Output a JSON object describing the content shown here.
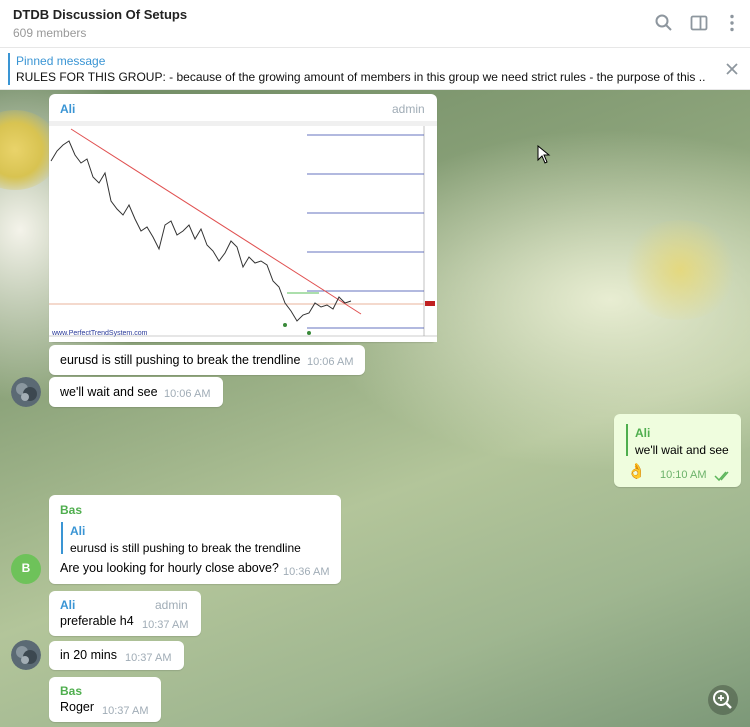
{
  "header": {
    "title": "DTDB Discussion Of Setups",
    "members": "609 members",
    "icons": [
      "search-icon",
      "sidebar-icon",
      "more-icon"
    ]
  },
  "pinned": {
    "title": "Pinned message",
    "text": "RULES FOR THIS GROUP:  - because of the growing amount of members in this group we need strict rules - the purpose of this ..."
  },
  "messages": [
    {
      "author": "Ali",
      "role": "admin",
      "has_image": true,
      "image_watermark": "www.PerfectTrendSystem.com",
      "text": "eurusd is still pushing to break the trendline",
      "time": "10:06 AM"
    },
    {
      "text": "we'll wait and see",
      "time": "10:06 AM"
    },
    {
      "outgoing": true,
      "reply_to": {
        "author": "Ali",
        "text": "we'll wait and see"
      },
      "text": "👌",
      "time": "10:10 AM"
    },
    {
      "author": "Bas",
      "avatar_letter": "B",
      "reply_to": {
        "author": "Ali",
        "text": "eurusd is still pushing to break the trendline"
      },
      "text": "Are you looking for hourly close above?",
      "time": "10:36 AM"
    },
    {
      "author": "Ali",
      "role": "admin",
      "text": "preferable h4",
      "time": "10:37 AM"
    },
    {
      "text": "in 20 mins",
      "time": "10:37 AM"
    },
    {
      "author": "Bas",
      "text": "Roger",
      "time": "10:37 AM"
    }
  ],
  "colors": {
    "accent": "#3a95d4",
    "ali_name": "#3a95d4",
    "bas_name": "#4fae4e",
    "bas_avatar": "#6ec25a",
    "outgoing_bubble": "#effdde"
  }
}
